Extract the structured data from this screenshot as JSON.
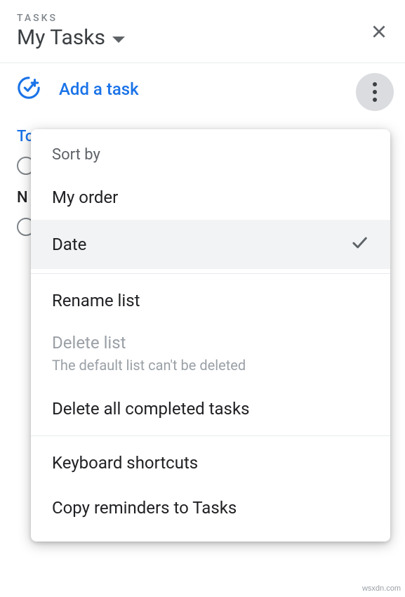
{
  "header": {
    "label": "TASKS",
    "list_title": "My Tasks"
  },
  "toolbar": {
    "add_task_label": "Add a task"
  },
  "tasks": {
    "group_label": "To",
    "no_date_label": "N"
  },
  "menu": {
    "sort_header": "Sort by",
    "items": [
      {
        "label": "My order",
        "selected": false
      },
      {
        "label": "Date",
        "selected": true
      }
    ],
    "rename": "Rename list",
    "delete_title": "Delete list",
    "delete_sub": "The default list can't be deleted",
    "delete_completed": "Delete all completed tasks",
    "shortcuts": "Keyboard shortcuts",
    "copy_reminders": "Copy reminders to Tasks"
  },
  "watermark": "wsxdn.com"
}
